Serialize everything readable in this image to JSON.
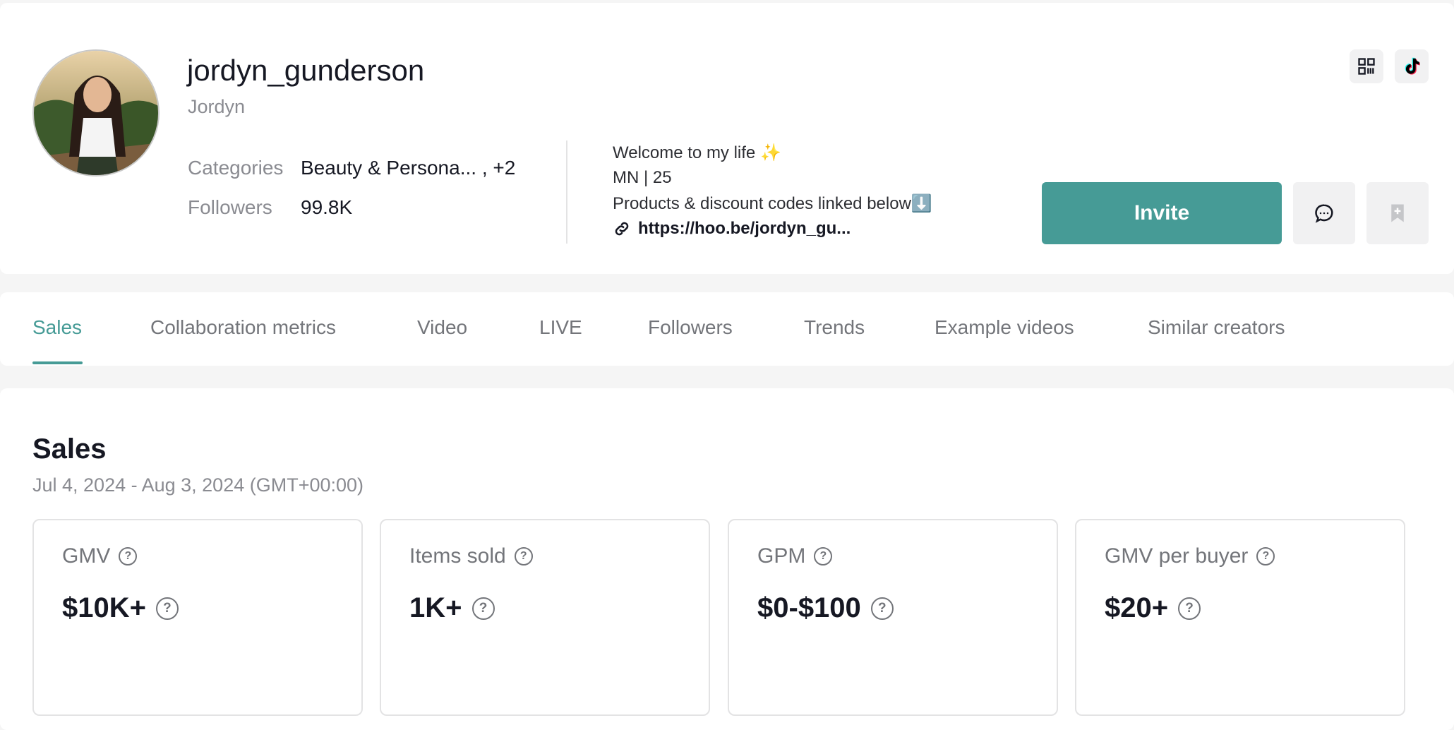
{
  "profile": {
    "username": "jordyn_gunderson",
    "nickname": "Jordyn",
    "categories_label": "Categories",
    "categories_value": "Beauty & Persona... , +2",
    "followers_label": "Followers",
    "followers_value": "99.8K",
    "bio": {
      "line1": "Welcome to my life ✨",
      "line2": "MN | 25",
      "line3": "Products & discount codes linked below⬇️",
      "link": "https://hoo.be/jordyn_gu..."
    }
  },
  "actions": {
    "invite_label": "Invite"
  },
  "tabs": [
    {
      "label": "Sales",
      "active": true
    },
    {
      "label": "Collaboration metrics",
      "active": false
    },
    {
      "label": "Video",
      "active": false
    },
    {
      "label": "LIVE",
      "active": false
    },
    {
      "label": "Followers",
      "active": false
    },
    {
      "label": "Trends",
      "active": false
    },
    {
      "label": "Example videos",
      "active": false
    },
    {
      "label": "Similar creators",
      "active": false
    }
  ],
  "sales": {
    "title": "Sales",
    "date_range": "Jul 4, 2024 - Aug 3, 2024 (GMT+00:00)",
    "metrics": [
      {
        "label": "GMV",
        "value": "$10K+"
      },
      {
        "label": "Items sold",
        "value": "1K+"
      },
      {
        "label": "GPM",
        "value": "$0-$100"
      },
      {
        "label": "GMV per buyer",
        "value": "$20+"
      }
    ]
  },
  "colors": {
    "accent": "#469b96",
    "text_primary": "#161823",
    "text_secondary": "#8a8b91",
    "background": "#f5f5f5"
  },
  "icons": [
    "qr-code-icon",
    "tiktok-icon",
    "message-icon",
    "bookmark-add-icon",
    "link-icon",
    "help-icon"
  ]
}
